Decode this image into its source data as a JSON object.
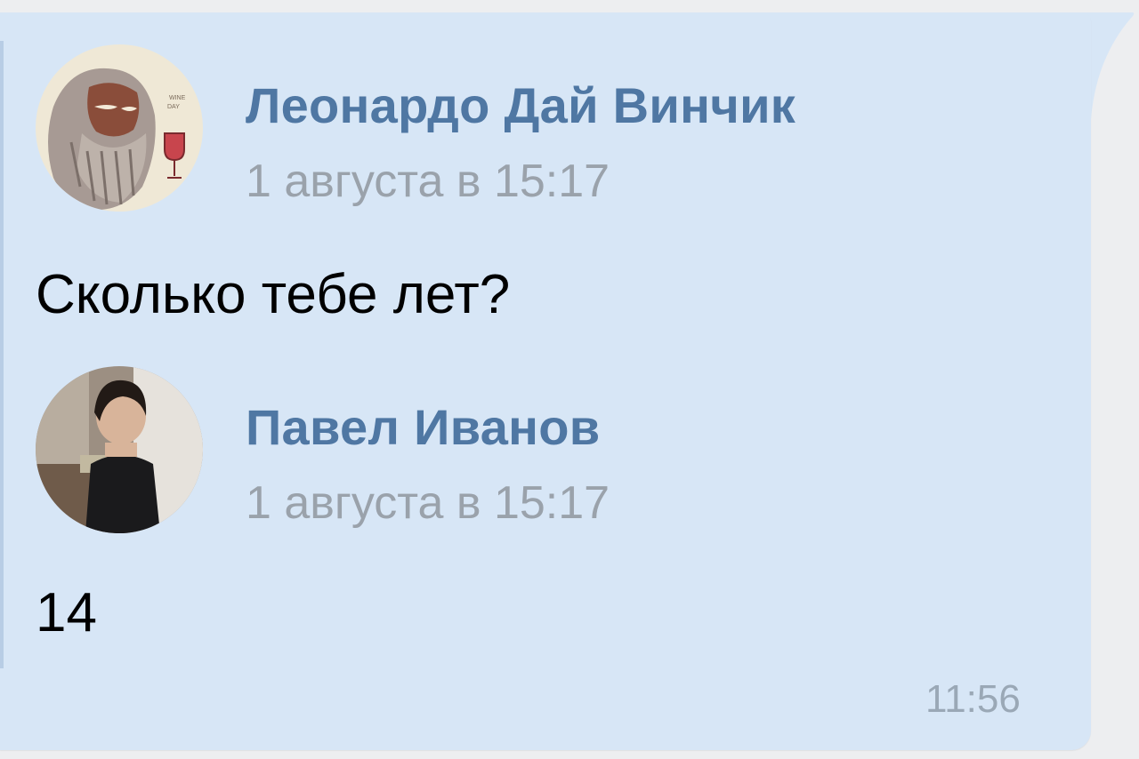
{
  "colors": {
    "background": "#edeef0",
    "bubble": "#d7e6f6",
    "author_link": "#4f77a3",
    "date_text": "#9aa2ab",
    "message_text": "#000000",
    "time_text": "#9aa8b6"
  },
  "forwarded": [
    {
      "author": "Леонардо Дай Винчик",
      "date": "1 августа в 15:17",
      "text": "Сколько тебе лет?",
      "avatar_icon": "avatar-leonardo-wine"
    },
    {
      "author": "Павел Иванов",
      "date": "1 августа в 15:17",
      "text": "14",
      "avatar_icon": "avatar-user-photo"
    }
  ],
  "message": {
    "time": "11:56"
  }
}
